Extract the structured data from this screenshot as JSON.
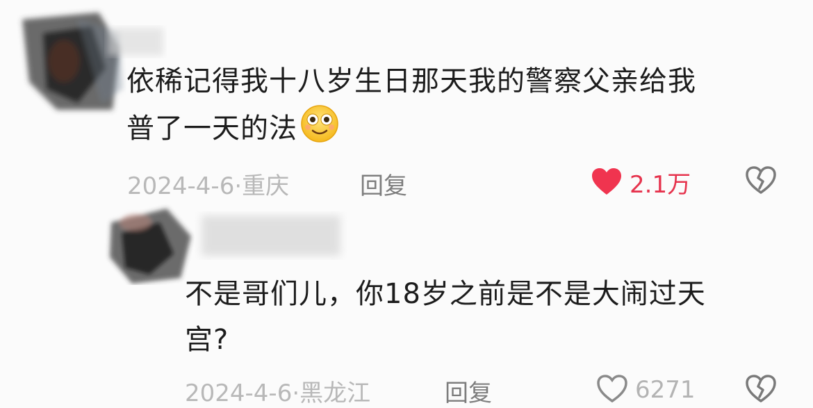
{
  "comments": [
    {
      "text_lines": [
        "依稀记得我十八岁生日那天我的警察父亲给我",
        "普了一天的法"
      ],
      "emoji": "smiling-face-emoji",
      "date": "2024-4-6",
      "location": "重庆",
      "separator": "·",
      "reply_label": "回复",
      "like_count": "2.1万",
      "liked": true
    },
    {
      "text_lines": [
        "不是哥们儿，你18岁之前是不是大闹过天",
        "宫?"
      ],
      "date": "2024-4-6",
      "location": "黑龙江",
      "separator": "·",
      "reply_label": "回复",
      "like_count": "6271",
      "liked": false
    }
  ],
  "icons": {
    "heart_filled": "heart-icon",
    "heart_outline": "heart-outline-icon",
    "dislike": "broken-heart-icon"
  },
  "colors": {
    "like_active": "#f0344f",
    "text": "#1c1c1c",
    "meta": "#b8b8b8",
    "reply": "#7d7d7d"
  }
}
